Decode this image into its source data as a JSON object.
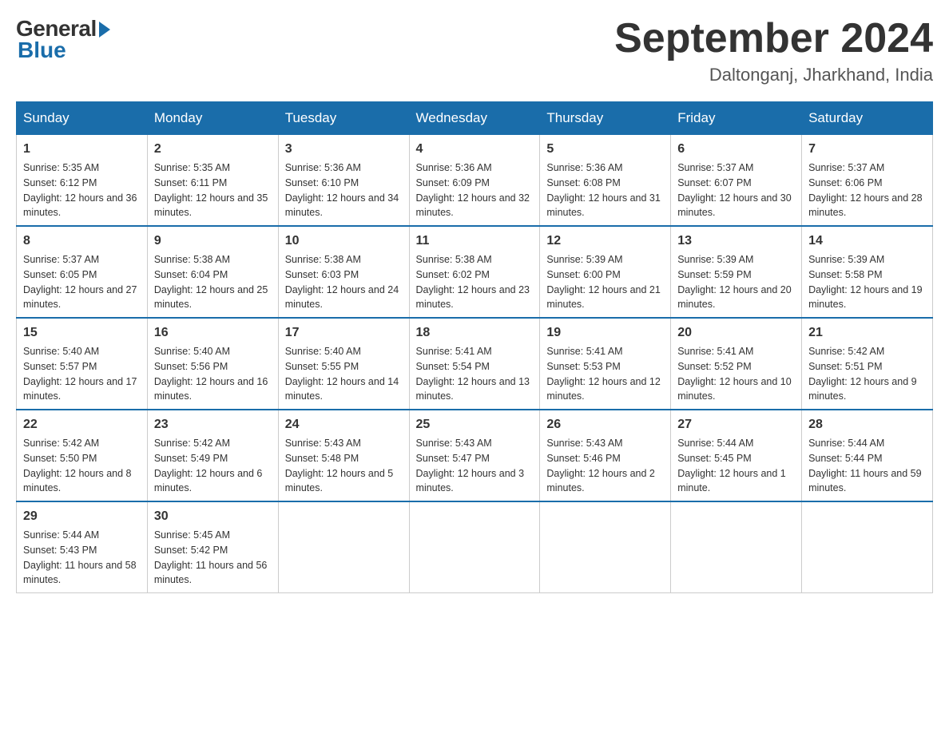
{
  "logo": {
    "general": "General",
    "blue": "Blue"
  },
  "title": "September 2024",
  "location": "Daltonganj, Jharkhand, India",
  "days_of_week": [
    "Sunday",
    "Monday",
    "Tuesday",
    "Wednesday",
    "Thursday",
    "Friday",
    "Saturday"
  ],
  "weeks": [
    [
      {
        "day": "1",
        "sunrise": "Sunrise: 5:35 AM",
        "sunset": "Sunset: 6:12 PM",
        "daylight": "Daylight: 12 hours and 36 minutes."
      },
      {
        "day": "2",
        "sunrise": "Sunrise: 5:35 AM",
        "sunset": "Sunset: 6:11 PM",
        "daylight": "Daylight: 12 hours and 35 minutes."
      },
      {
        "day": "3",
        "sunrise": "Sunrise: 5:36 AM",
        "sunset": "Sunset: 6:10 PM",
        "daylight": "Daylight: 12 hours and 34 minutes."
      },
      {
        "day": "4",
        "sunrise": "Sunrise: 5:36 AM",
        "sunset": "Sunset: 6:09 PM",
        "daylight": "Daylight: 12 hours and 32 minutes."
      },
      {
        "day": "5",
        "sunrise": "Sunrise: 5:36 AM",
        "sunset": "Sunset: 6:08 PM",
        "daylight": "Daylight: 12 hours and 31 minutes."
      },
      {
        "day": "6",
        "sunrise": "Sunrise: 5:37 AM",
        "sunset": "Sunset: 6:07 PM",
        "daylight": "Daylight: 12 hours and 30 minutes."
      },
      {
        "day": "7",
        "sunrise": "Sunrise: 5:37 AM",
        "sunset": "Sunset: 6:06 PM",
        "daylight": "Daylight: 12 hours and 28 minutes."
      }
    ],
    [
      {
        "day": "8",
        "sunrise": "Sunrise: 5:37 AM",
        "sunset": "Sunset: 6:05 PM",
        "daylight": "Daylight: 12 hours and 27 minutes."
      },
      {
        "day": "9",
        "sunrise": "Sunrise: 5:38 AM",
        "sunset": "Sunset: 6:04 PM",
        "daylight": "Daylight: 12 hours and 25 minutes."
      },
      {
        "day": "10",
        "sunrise": "Sunrise: 5:38 AM",
        "sunset": "Sunset: 6:03 PM",
        "daylight": "Daylight: 12 hours and 24 minutes."
      },
      {
        "day": "11",
        "sunrise": "Sunrise: 5:38 AM",
        "sunset": "Sunset: 6:02 PM",
        "daylight": "Daylight: 12 hours and 23 minutes."
      },
      {
        "day": "12",
        "sunrise": "Sunrise: 5:39 AM",
        "sunset": "Sunset: 6:00 PM",
        "daylight": "Daylight: 12 hours and 21 minutes."
      },
      {
        "day": "13",
        "sunrise": "Sunrise: 5:39 AM",
        "sunset": "Sunset: 5:59 PM",
        "daylight": "Daylight: 12 hours and 20 minutes."
      },
      {
        "day": "14",
        "sunrise": "Sunrise: 5:39 AM",
        "sunset": "Sunset: 5:58 PM",
        "daylight": "Daylight: 12 hours and 19 minutes."
      }
    ],
    [
      {
        "day": "15",
        "sunrise": "Sunrise: 5:40 AM",
        "sunset": "Sunset: 5:57 PM",
        "daylight": "Daylight: 12 hours and 17 minutes."
      },
      {
        "day": "16",
        "sunrise": "Sunrise: 5:40 AM",
        "sunset": "Sunset: 5:56 PM",
        "daylight": "Daylight: 12 hours and 16 minutes."
      },
      {
        "day": "17",
        "sunrise": "Sunrise: 5:40 AM",
        "sunset": "Sunset: 5:55 PM",
        "daylight": "Daylight: 12 hours and 14 minutes."
      },
      {
        "day": "18",
        "sunrise": "Sunrise: 5:41 AM",
        "sunset": "Sunset: 5:54 PM",
        "daylight": "Daylight: 12 hours and 13 minutes."
      },
      {
        "day": "19",
        "sunrise": "Sunrise: 5:41 AM",
        "sunset": "Sunset: 5:53 PM",
        "daylight": "Daylight: 12 hours and 12 minutes."
      },
      {
        "day": "20",
        "sunrise": "Sunrise: 5:41 AM",
        "sunset": "Sunset: 5:52 PM",
        "daylight": "Daylight: 12 hours and 10 minutes."
      },
      {
        "day": "21",
        "sunrise": "Sunrise: 5:42 AM",
        "sunset": "Sunset: 5:51 PM",
        "daylight": "Daylight: 12 hours and 9 minutes."
      }
    ],
    [
      {
        "day": "22",
        "sunrise": "Sunrise: 5:42 AM",
        "sunset": "Sunset: 5:50 PM",
        "daylight": "Daylight: 12 hours and 8 minutes."
      },
      {
        "day": "23",
        "sunrise": "Sunrise: 5:42 AM",
        "sunset": "Sunset: 5:49 PM",
        "daylight": "Daylight: 12 hours and 6 minutes."
      },
      {
        "day": "24",
        "sunrise": "Sunrise: 5:43 AM",
        "sunset": "Sunset: 5:48 PM",
        "daylight": "Daylight: 12 hours and 5 minutes."
      },
      {
        "day": "25",
        "sunrise": "Sunrise: 5:43 AM",
        "sunset": "Sunset: 5:47 PM",
        "daylight": "Daylight: 12 hours and 3 minutes."
      },
      {
        "day": "26",
        "sunrise": "Sunrise: 5:43 AM",
        "sunset": "Sunset: 5:46 PM",
        "daylight": "Daylight: 12 hours and 2 minutes."
      },
      {
        "day": "27",
        "sunrise": "Sunrise: 5:44 AM",
        "sunset": "Sunset: 5:45 PM",
        "daylight": "Daylight: 12 hours and 1 minute."
      },
      {
        "day": "28",
        "sunrise": "Sunrise: 5:44 AM",
        "sunset": "Sunset: 5:44 PM",
        "daylight": "Daylight: 11 hours and 59 minutes."
      }
    ],
    [
      {
        "day": "29",
        "sunrise": "Sunrise: 5:44 AM",
        "sunset": "Sunset: 5:43 PM",
        "daylight": "Daylight: 11 hours and 58 minutes."
      },
      {
        "day": "30",
        "sunrise": "Sunrise: 5:45 AM",
        "sunset": "Sunset: 5:42 PM",
        "daylight": "Daylight: 11 hours and 56 minutes."
      },
      null,
      null,
      null,
      null,
      null
    ]
  ]
}
